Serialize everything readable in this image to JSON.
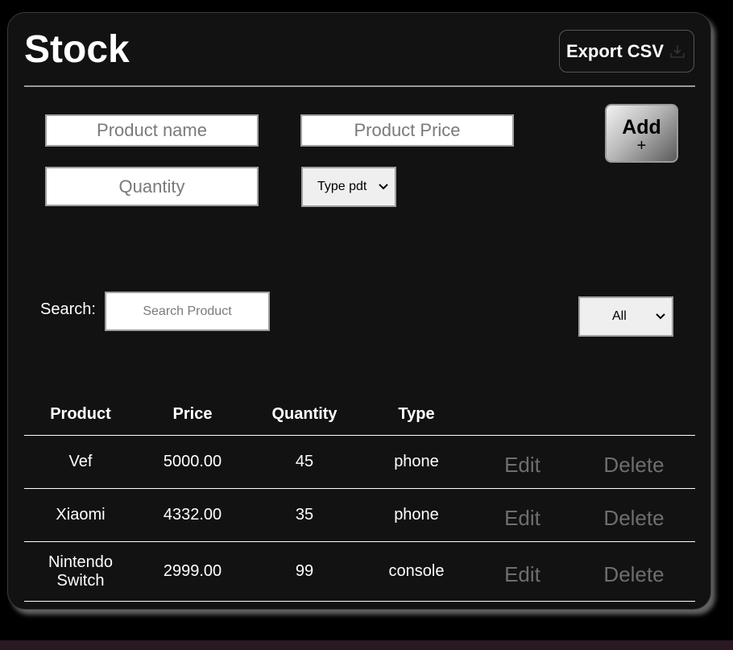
{
  "page": {
    "title": "Stock",
    "export_label": "Export CSV",
    "export_icon": "download-icon"
  },
  "form": {
    "product_name_placeholder": "Product name",
    "product_price_placeholder": "Product Price",
    "quantity_placeholder": "Quantity",
    "type_select_value": "Type pdt",
    "add_label": "Add",
    "add_plus": "+"
  },
  "search": {
    "label": "Search:",
    "placeholder": "Search Product",
    "filter_value": "All"
  },
  "table": {
    "headers": [
      "Product",
      "Price",
      "Quantity",
      "Type",
      "",
      ""
    ],
    "rows": [
      {
        "product": "Vef",
        "price": "5000.00",
        "quantity": "45",
        "type": "phone",
        "edit": "Edit",
        "delete": "Delete"
      },
      {
        "product": "Xiaomi",
        "price": "4332.00",
        "quantity": "35",
        "type": "phone",
        "edit": "Edit",
        "delete": "Delete"
      },
      {
        "product": "Nintendo Switch",
        "price": "2999.00",
        "quantity": "99",
        "type": "console",
        "edit": "Edit",
        "delete": "Delete"
      }
    ]
  },
  "colors": {
    "background": "#000000",
    "card": "#121212",
    "text": "#ffffff",
    "muted_action": "#6e6e6e"
  }
}
